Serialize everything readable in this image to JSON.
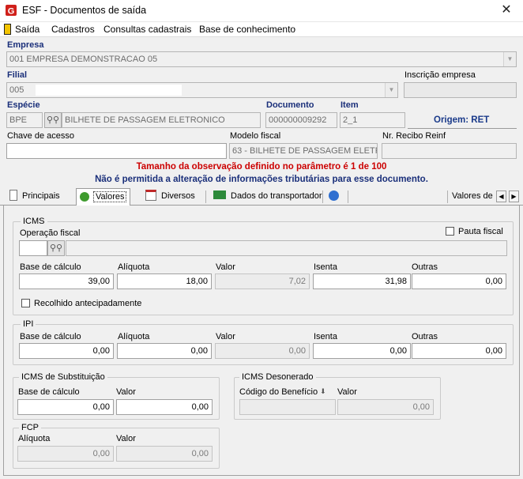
{
  "window": {
    "title": "ESF - Documentos de saída",
    "close": "✕"
  },
  "menu": [
    "Saída",
    "Cadastros",
    "Consultas cadastrais",
    "Base de conhecimento"
  ],
  "empresa": {
    "label": "Empresa",
    "value": "001 EMPRESA DEMONSTRACAO 05"
  },
  "filial": {
    "label": "Filial",
    "value": "005"
  },
  "inscricao": {
    "label": "Inscrição empresa",
    "value": ""
  },
  "especie": {
    "label": "Espécie",
    "code": "BPE",
    "description": "BILHETE DE PASSAGEM ELETRONICO"
  },
  "documento": {
    "label": "Documento",
    "value": "000000009292"
  },
  "item": {
    "label": "Item",
    "value": "2_1"
  },
  "origem": {
    "text": "Origem: RET"
  },
  "chave": {
    "label": "Chave de acesso",
    "value": ""
  },
  "modelo": {
    "label": "Modelo fiscal",
    "value": "63 - BILHETE DE PASSAGEM ELETR"
  },
  "recibo": {
    "label": "Nr. Recibo Reinf",
    "value": ""
  },
  "warnings": {
    "line1": "Tamanho da observação definido no parâmetro é 1 de 100",
    "line2": "Não é permitida a alteração de informações tributárias para esse documento."
  },
  "tabs": [
    "Principais",
    "Valores",
    "Diversos",
    "Dados do transportador",
    "Valores de"
  ],
  "icms": {
    "title": "ICMS",
    "operacao_label": "Operação fiscal",
    "operacao_code": "",
    "operacao_desc": "",
    "pauta_label": "Pauta fiscal",
    "base_label": "Base de cálculo",
    "base": "39,00",
    "aliquota_label": "Alíquota",
    "aliquota": "18,00",
    "valor_label": "Valor",
    "valor": "7,02",
    "isenta_label": "Isenta",
    "isenta": "31,98",
    "outras_label": "Outras",
    "outras": "0,00",
    "recolhido_label": "Recolhido antecipadamente"
  },
  "ipi": {
    "title": "IPI",
    "base_label": "Base de cálculo",
    "base": "0,00",
    "aliquota_label": "Alíquota",
    "aliquota": "0,00",
    "valor_label": "Valor",
    "valor": "0,00",
    "isenta_label": "Isenta",
    "isenta": "0,00",
    "outras_label": "Outras",
    "outras": "0,00"
  },
  "icms_st": {
    "title": "ICMS de Substituição",
    "base_label": "Base de cálculo",
    "base": "0,00",
    "valor_label": "Valor",
    "valor": "0,00"
  },
  "icms_des": {
    "title": "ICMS Desonerado",
    "codigo_label": "Código do Benefício",
    "codigo": "",
    "valor_label": "Valor",
    "valor": "0,00"
  },
  "fcp": {
    "title": "FCP",
    "aliquota_label": "Alíquota",
    "aliquota": "0,00",
    "valor_label": "Valor",
    "valor": "0,00"
  },
  "colors": {
    "label_blue": "#1a2f7a",
    "warning_red": "#cc0000",
    "warning_blue": "#1a2f7a",
    "origem_blue": "#1a3a8a"
  }
}
